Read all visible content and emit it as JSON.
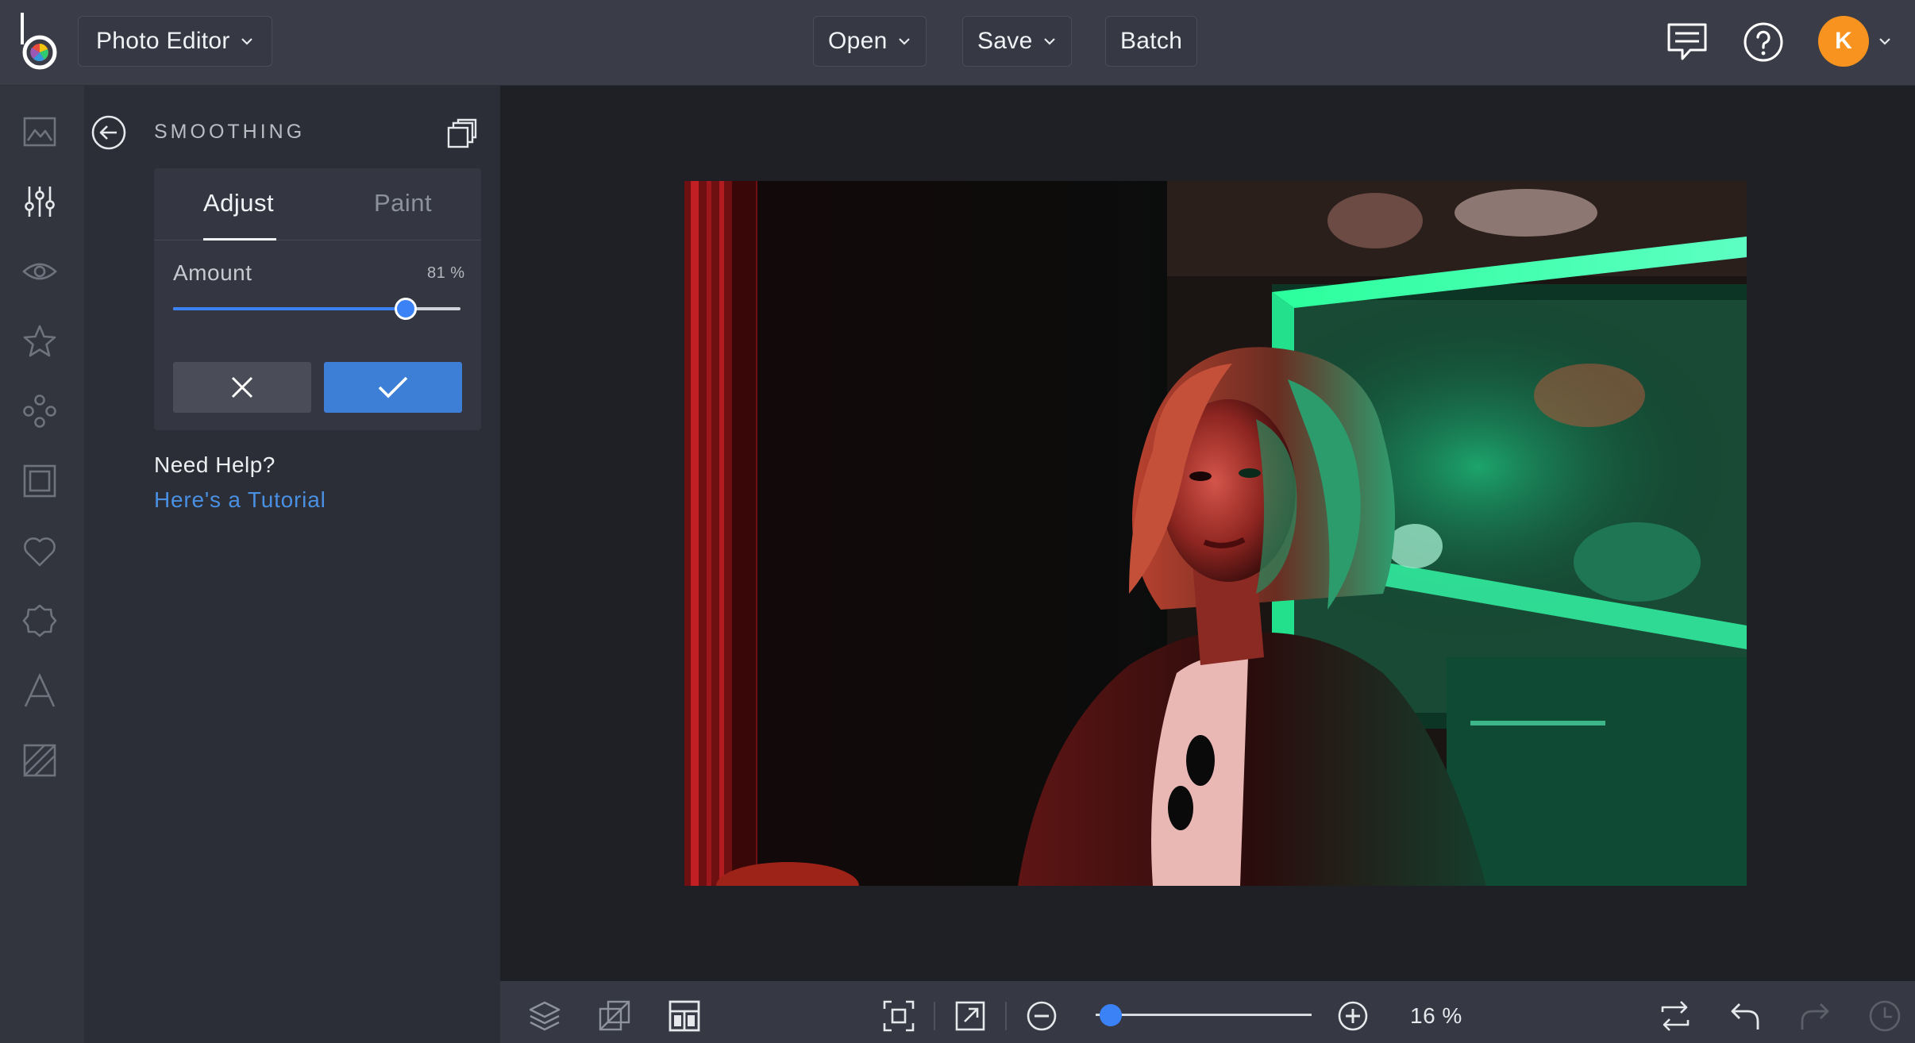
{
  "topbar": {
    "app_menu_label": "Photo Editor",
    "open_label": "Open",
    "save_label": "Save",
    "batch_label": "Batch",
    "avatar_initial": "K"
  },
  "rail": {
    "tools": [
      {
        "icon": "image-icon"
      },
      {
        "icon": "sliders-icon",
        "active": true
      },
      {
        "icon": "eye-icon"
      },
      {
        "icon": "star-icon"
      },
      {
        "icon": "cluster-icon"
      },
      {
        "icon": "frame-icon"
      },
      {
        "icon": "heart-icon"
      },
      {
        "icon": "badge-icon"
      },
      {
        "icon": "text-icon"
      },
      {
        "icon": "texture-icon"
      }
    ]
  },
  "panel": {
    "title": "SMOOTHING",
    "tabs": [
      {
        "label": "Adjust",
        "active": true
      },
      {
        "label": "Paint",
        "active": false
      }
    ],
    "amount_label": "Amount",
    "amount_value_text": "81 %",
    "amount_percent": 81,
    "help_title": "Need Help?",
    "help_link": "Here's a Tutorial"
  },
  "bottombar": {
    "zoom_text": "16 %",
    "zoom_fraction": 0.07
  },
  "colors": {
    "accent": "#3b82f6",
    "avatar": "#f7931e",
    "link": "#4a90e2"
  }
}
